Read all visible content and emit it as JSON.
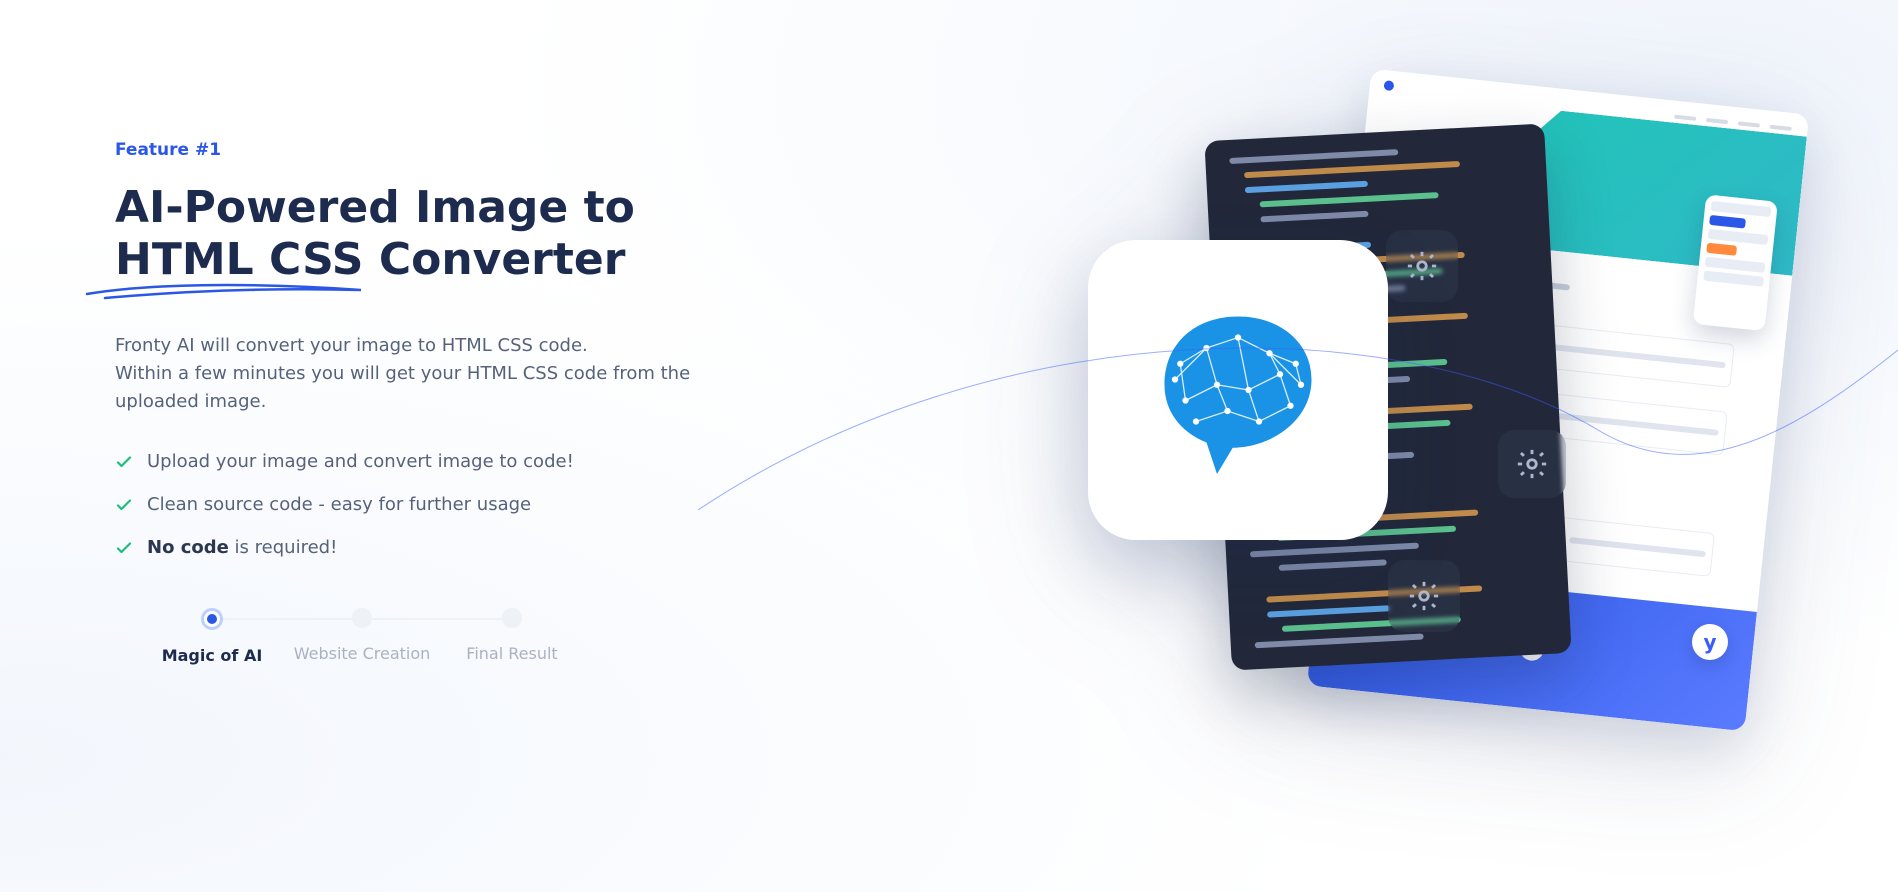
{
  "eyebrow": "Feature #1",
  "heading_line1": "AI-Powered Image to",
  "heading_line2_underlined": "HTML CSS",
  "heading_line2_rest": " Converter",
  "lead_line1": "Fronty AI will convert your image to HTML CSS code.",
  "lead_line2": "Within a few minutes you will get your HTML CSS code from the uploaded image.",
  "bullets": {
    "b0": "Upload your image and convert image to code!",
    "b1": "Clean source code - easy for further usage",
    "b2_strong": "No code",
    "b2_rest": " is required!"
  },
  "steps": {
    "s0": "Magic of AI",
    "s1": "Website Creation",
    "s2": "Final Result"
  },
  "colors": {
    "accent": "#2b57e6",
    "heading": "#1d2b4f",
    "body": "#56627a"
  }
}
